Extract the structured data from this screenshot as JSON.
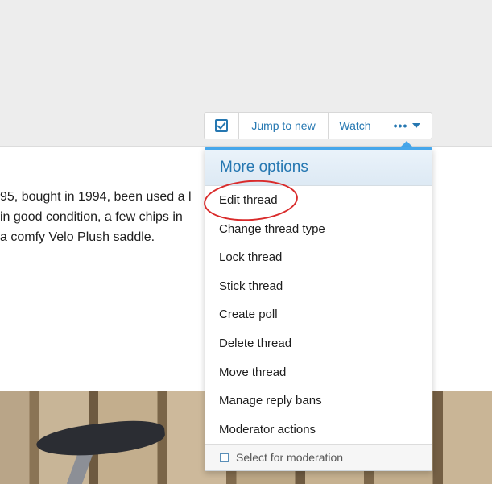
{
  "post": {
    "lines": [
      "95, bought in 1994, been used a l",
      "in good condition, a few chips in",
      "a comfy Velo Plush saddle."
    ]
  },
  "toolbar": {
    "jump_label": "Jump to new",
    "watch_label": "Watch",
    "more_label": "•••"
  },
  "menu": {
    "title": "More options",
    "items": [
      "Edit thread",
      "Change thread type",
      "Lock thread",
      "Stick thread",
      "Create poll",
      "Delete thread",
      "Move thread",
      "Manage reply bans",
      "Moderator actions"
    ],
    "footer_label": "Select for moderation"
  },
  "colors": {
    "accent": "#2577b1",
    "menu_top_border": "#47a7eb",
    "annotation": "#d92b2b"
  }
}
